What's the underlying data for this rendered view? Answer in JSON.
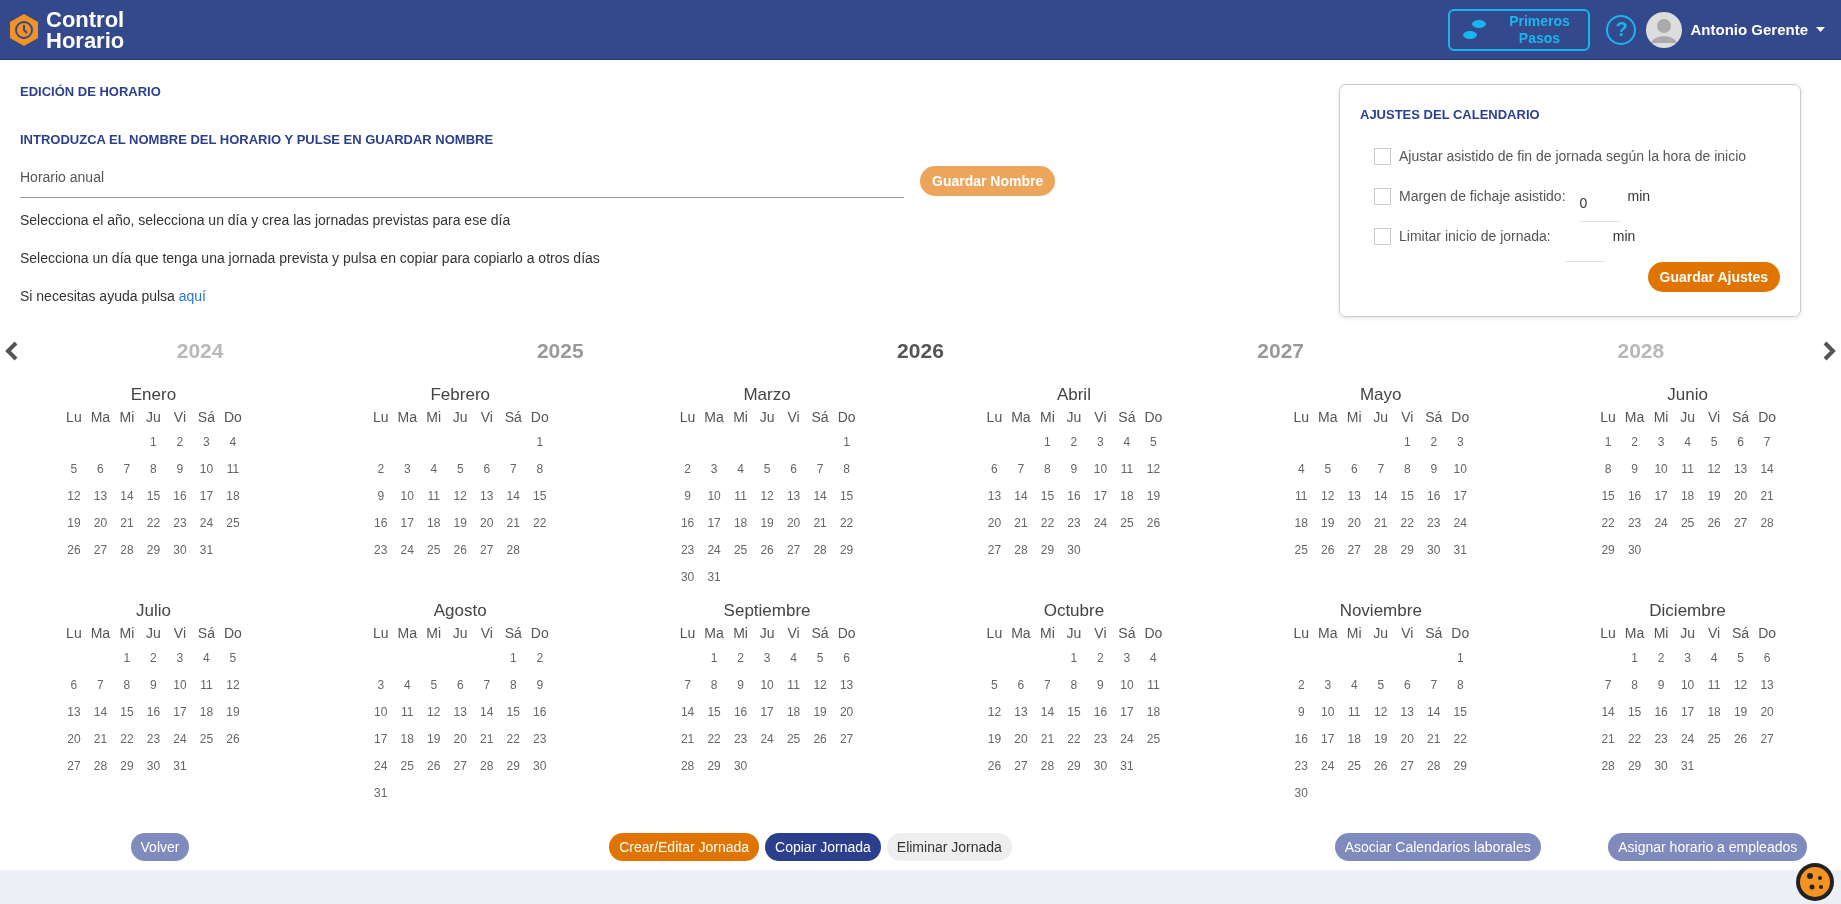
{
  "header": {
    "logo_lines": [
      "Control",
      "Horario"
    ],
    "first_steps_lines": [
      "Primeros",
      "Pasos"
    ],
    "help": "?",
    "user_name": "Antonio Gerente"
  },
  "page_title": "EDICIÓN DE HORARIO",
  "name_prompt": "INTRODUZCA EL NOMBRE DEL HORARIO Y PULSE EN GUARDAR NOMBRE",
  "name_field": {
    "value": "Horario anual"
  },
  "save_name_button": "Guardar Nombre",
  "instructions": [
    "Selecciona el año, selecciona un día y crea las jornadas previstas para ese día",
    "Selecciona un día que tenga una jornada prevista y pulsa en copiar para copiarlo a otros días"
  ],
  "help_line": {
    "text": "Si necesitas ayuda pulsa ",
    "link": "aquí"
  },
  "settings": {
    "title": "AJUSTES DEL CALENDARIO",
    "options": [
      {
        "kind": "check",
        "label": "Ajustar asistido de fin de jornada según la hora de inicio",
        "checked": false
      },
      {
        "kind": "minutes",
        "label": "Margen de fichaje asistido:",
        "checked": false,
        "value": "0",
        "unit": "min"
      },
      {
        "kind": "minutes",
        "label": "Limitar inicio de jornada:",
        "checked": false,
        "unit": "min"
      }
    ],
    "save_button": "Guardar Ajustes"
  },
  "years": [
    {
      "label": "2024",
      "selected": false,
      "near": false
    },
    {
      "label": "2025",
      "selected": false,
      "near": true
    },
    {
      "label": "2026",
      "selected": true,
      "near": true
    },
    {
      "label": "2027",
      "selected": false,
      "near": true
    },
    {
      "label": "2028",
      "selected": false,
      "near": false
    }
  ],
  "months": [
    {
      "name": "Enero",
      "weekdays": [
        "Lu",
        "Ma",
        "Mi",
        "Ju",
        "Vi",
        "Sá",
        "Do"
      ],
      "weeks": [
        [
          "1",
          "2",
          "3",
          "4"
        ],
        [
          "5",
          "6",
          "7",
          "8",
          "9",
          "10",
          "11"
        ],
        [
          "12",
          "13",
          "14",
          "15",
          "16",
          "17",
          "18"
        ],
        [
          "19",
          "20",
          "21",
          "22",
          "23",
          "24",
          "25"
        ],
        [
          "26",
          "27",
          "28",
          "29",
          "30",
          "31"
        ]
      ]
    },
    {
      "name": "Febrero",
      "weekdays": [
        "Lu",
        "Ma",
        "Mi",
        "Ju",
        "Vi",
        "Sá",
        "Do"
      ],
      "weeks": [
        [
          "1"
        ],
        [
          "2",
          "3",
          "4",
          "5",
          "6",
          "7",
          "8"
        ],
        [
          "9",
          "10",
          "11",
          "12",
          "13",
          "14",
          "15"
        ],
        [
          "16",
          "17",
          "18",
          "19",
          "20",
          "21",
          "22"
        ],
        [
          "23",
          "24",
          "25",
          "26",
          "27",
          "28"
        ]
      ]
    },
    {
      "name": "Marzo",
      "weekdays": [
        "Lu",
        "Ma",
        "Mi",
        "Ju",
        "Vi",
        "Sá",
        "Do"
      ],
      "weeks": [
        [
          "1"
        ],
        [
          "2",
          "3",
          "4",
          "5",
          "6",
          "7",
          "8"
        ],
        [
          "9",
          "10",
          "11",
          "12",
          "13",
          "14",
          "15"
        ],
        [
          "16",
          "17",
          "18",
          "19",
          "20",
          "21",
          "22"
        ],
        [
          "23",
          "24",
          "25",
          "26",
          "27",
          "28",
          "29"
        ],
        [
          "30",
          "31"
        ]
      ]
    },
    {
      "name": "Abril",
      "weekdays": [
        "Lu",
        "Ma",
        "Mi",
        "Ju",
        "Vi",
        "Sá",
        "Do"
      ],
      "weeks": [
        [
          "1",
          "2",
          "3",
          "4",
          "5"
        ],
        [
          "6",
          "7",
          "8",
          "9",
          "10",
          "11",
          "12"
        ],
        [
          "13",
          "14",
          "15",
          "16",
          "17",
          "18",
          "19"
        ],
        [
          "20",
          "21",
          "22",
          "23",
          "24",
          "25",
          "26"
        ],
        [
          "27",
          "28",
          "29",
          "30"
        ]
      ]
    },
    {
      "name": "Mayo",
      "weekdays": [
        "Lu",
        "Ma",
        "Mi",
        "Ju",
        "Vi",
        "Sá",
        "Do"
      ],
      "weeks": [
        [
          "1",
          "2",
          "3"
        ],
        [
          "4",
          "5",
          "6",
          "7",
          "8",
          "9",
          "10"
        ],
        [
          "11",
          "12",
          "13",
          "14",
          "15",
          "16",
          "17"
        ],
        [
          "18",
          "19",
          "20",
          "21",
          "22",
          "23",
          "24"
        ],
        [
          "25",
          "26",
          "27",
          "28",
          "29",
          "30",
          "31"
        ]
      ]
    },
    {
      "name": "Junio",
      "weekdays": [
        "Lu",
        "Ma",
        "Mi",
        "Ju",
        "Vi",
        "Sá",
        "Do"
      ],
      "weeks": [
        [
          "1",
          "2",
          "3",
          "4",
          "5",
          "6",
          "7"
        ],
        [
          "8",
          "9",
          "10",
          "11",
          "12",
          "13",
          "14"
        ],
        [
          "15",
          "16",
          "17",
          "18",
          "19",
          "20",
          "21"
        ],
        [
          "22",
          "23",
          "24",
          "25",
          "26",
          "27",
          "28"
        ],
        [
          "29",
          "30"
        ]
      ]
    },
    {
      "name": "Julio",
      "weekdays": [
        "Lu",
        "Ma",
        "Mi",
        "Ju",
        "Vi",
        "Sá",
        "Do"
      ],
      "weeks": [
        [
          "1",
          "2",
          "3",
          "4",
          "5"
        ],
        [
          "6",
          "7",
          "8",
          "9",
          "10",
          "11",
          "12"
        ],
        [
          "13",
          "14",
          "15",
          "16",
          "17",
          "18",
          "19"
        ],
        [
          "20",
          "21",
          "22",
          "23",
          "24",
          "25",
          "26"
        ],
        [
          "27",
          "28",
          "29",
          "30",
          "31"
        ]
      ]
    },
    {
      "name": "Agosto",
      "weekdays": [
        "Lu",
        "Ma",
        "Mi",
        "Ju",
        "Vi",
        "Sá",
        "Do"
      ],
      "weeks": [
        [
          "1",
          "2"
        ],
        [
          "3",
          "4",
          "5",
          "6",
          "7",
          "8",
          "9"
        ],
        [
          "10",
          "11",
          "12",
          "13",
          "14",
          "15",
          "16"
        ],
        [
          "17",
          "18",
          "19",
          "20",
          "21",
          "22",
          "23"
        ],
        [
          "24",
          "25",
          "26",
          "27",
          "28",
          "29",
          "30"
        ],
        [
          "31"
        ]
      ]
    },
    {
      "name": "Septiembre",
      "weekdays": [
        "Lu",
        "Ma",
        "Mi",
        "Ju",
        "Vi",
        "Sá",
        "Do"
      ],
      "weeks": [
        [
          "1",
          "2",
          "3",
          "4",
          "5",
          "6"
        ],
        [
          "7",
          "8",
          "9",
          "10",
          "11",
          "12",
          "13"
        ],
        [
          "14",
          "15",
          "16",
          "17",
          "18",
          "19",
          "20"
        ],
        [
          "21",
          "22",
          "23",
          "24",
          "25",
          "26",
          "27"
        ],
        [
          "28",
          "29",
          "30"
        ]
      ]
    },
    {
      "name": "Octubre",
      "weekdays": [
        "Lu",
        "Ma",
        "Mi",
        "Ju",
        "Vi",
        "Sá",
        "Do"
      ],
      "weeks": [
        [
          "1",
          "2",
          "3",
          "4"
        ],
        [
          "5",
          "6",
          "7",
          "8",
          "9",
          "10",
          "11"
        ],
        [
          "12",
          "13",
          "14",
          "15",
          "16",
          "17",
          "18"
        ],
        [
          "19",
          "20",
          "21",
          "22",
          "23",
          "24",
          "25"
        ],
        [
          "26",
          "27",
          "28",
          "29",
          "30",
          "31"
        ]
      ]
    },
    {
      "name": "Noviembre",
      "weekdays": [
        "Lu",
        "Ma",
        "Mi",
        "Ju",
        "Vi",
        "Sá",
        "Do"
      ],
      "weeks": [
        [
          "1"
        ],
        [
          "2",
          "3",
          "4",
          "5",
          "6",
          "7",
          "8"
        ],
        [
          "9",
          "10",
          "11",
          "12",
          "13",
          "14",
          "15"
        ],
        [
          "16",
          "17",
          "18",
          "19",
          "20",
          "21",
          "22"
        ],
        [
          "23",
          "24",
          "25",
          "26",
          "27",
          "28",
          "29"
        ],
        [
          "30"
        ]
      ]
    },
    {
      "name": "Diciembre",
      "weekdays": [
        "Lu",
        "Ma",
        "Mi",
        "Ju",
        "Vi",
        "Sá",
        "Do"
      ],
      "weeks": [
        [
          "1",
          "2",
          "3",
          "4",
          "5",
          "6"
        ],
        [
          "7",
          "8",
          "9",
          "10",
          "11",
          "12",
          "13"
        ],
        [
          "14",
          "15",
          "16",
          "17",
          "18",
          "19",
          "20"
        ],
        [
          "21",
          "22",
          "23",
          "24",
          "25",
          "26",
          "27"
        ],
        [
          "28",
          "29",
          "30",
          "31"
        ]
      ]
    }
  ],
  "actions": [
    {
      "label": "Volver",
      "kind": "muted"
    },
    {
      "label": "Crear/Editar Jornada",
      "kind": "primary"
    },
    {
      "label": "Copiar Jornada",
      "kind": "dark"
    },
    {
      "label": "Eliminar Jornada",
      "kind": "light"
    },
    {
      "label": "Asociar Calendarios laborales",
      "kind": "muted"
    },
    {
      "label": "Asignar horario a empleados",
      "kind": "muted"
    }
  ]
}
